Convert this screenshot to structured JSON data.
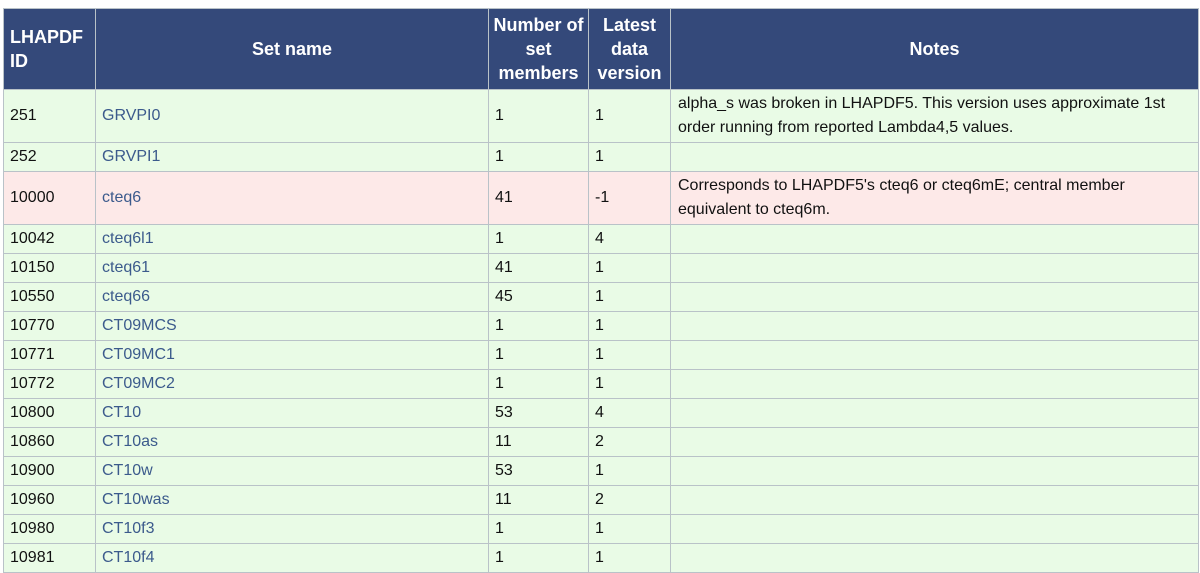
{
  "headers": {
    "id": "LHAPDF ID",
    "set_name": "Set name",
    "members": "Number of set members",
    "version": "Latest data version",
    "notes": "Notes"
  },
  "rows": [
    {
      "id": "251",
      "name": "GRVPI0",
      "members": "1",
      "version": "1",
      "notes": "alpha_s was broken in LHAPDF5. This version uses approximate 1st order running from reported Lambda4,5 values.",
      "status": "ok"
    },
    {
      "id": "252",
      "name": "GRVPI1",
      "members": "1",
      "version": "1",
      "notes": "",
      "status": "ok"
    },
    {
      "id": "10000",
      "name": "cteq6",
      "members": "41",
      "version": "-1",
      "notes": "Corresponds to LHAPDF5's cteq6 or cteq6mE; central member equivalent to cteq6m.",
      "status": "warn"
    },
    {
      "id": "10042",
      "name": "cteq6l1",
      "members": "1",
      "version": "4",
      "notes": "",
      "status": "ok"
    },
    {
      "id": "10150",
      "name": "cteq61",
      "members": "41",
      "version": "1",
      "notes": "",
      "status": "ok"
    },
    {
      "id": "10550",
      "name": "cteq66",
      "members": "45",
      "version": "1",
      "notes": "",
      "status": "ok"
    },
    {
      "id": "10770",
      "name": "CT09MCS",
      "members": "1",
      "version": "1",
      "notes": "",
      "status": "ok"
    },
    {
      "id": "10771",
      "name": "CT09MC1",
      "members": "1",
      "version": "1",
      "notes": "",
      "status": "ok"
    },
    {
      "id": "10772",
      "name": "CT09MC2",
      "members": "1",
      "version": "1",
      "notes": "",
      "status": "ok"
    },
    {
      "id": "10800",
      "name": "CT10",
      "members": "53",
      "version": "4",
      "notes": "",
      "status": "ok"
    },
    {
      "id": "10860",
      "name": "CT10as",
      "members": "11",
      "version": "2",
      "notes": "",
      "status": "ok"
    },
    {
      "id": "10900",
      "name": "CT10w",
      "members": "53",
      "version": "1",
      "notes": "",
      "status": "ok"
    },
    {
      "id": "10960",
      "name": "CT10was",
      "members": "11",
      "version": "2",
      "notes": "",
      "status": "ok"
    },
    {
      "id": "10980",
      "name": "CT10f3",
      "members": "1",
      "version": "1",
      "notes": "",
      "status": "ok"
    },
    {
      "id": "10981",
      "name": "CT10f4",
      "members": "1",
      "version": "1",
      "notes": "",
      "status": "ok"
    }
  ],
  "colors": {
    "header_bg": "#34497a",
    "row_ok_bg": "#e9fbe6",
    "row_warn_bg": "#fde9e8",
    "link": "#3b5a8c"
  }
}
